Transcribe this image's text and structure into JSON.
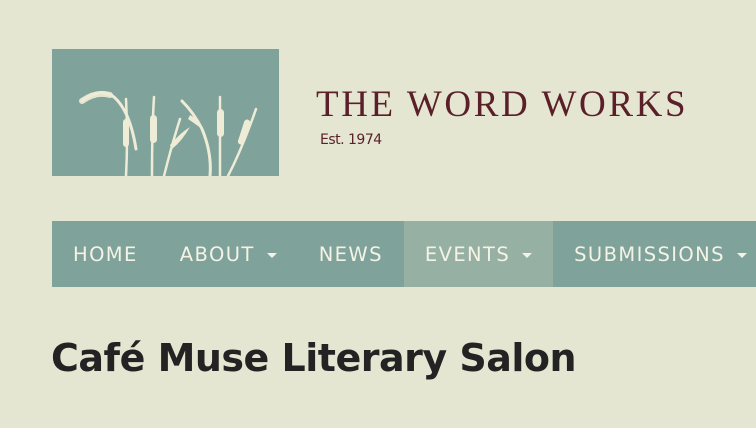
{
  "header": {
    "title": "THE WORD WORKS",
    "tagline": "Est. 1974"
  },
  "nav": {
    "items": [
      {
        "label": "HOME"
      },
      {
        "label": "ABOUT"
      },
      {
        "label": "NEWS"
      },
      {
        "label": "EVENTS"
      },
      {
        "label": "SUBMISSIONS"
      }
    ],
    "active": "EVENTS"
  },
  "main": {
    "page_title": "Café Muse Literary Salon"
  },
  "colors": {
    "background": "#e4e6d1",
    "nav_background": "#7fa29b",
    "nav_active": "#97b0a4",
    "title_color": "#5a1f28",
    "logo_reeds": "#eeecd6"
  },
  "icons": {
    "logo": "reeds-logo-icon",
    "dropdown": "chevron-down-icon"
  }
}
